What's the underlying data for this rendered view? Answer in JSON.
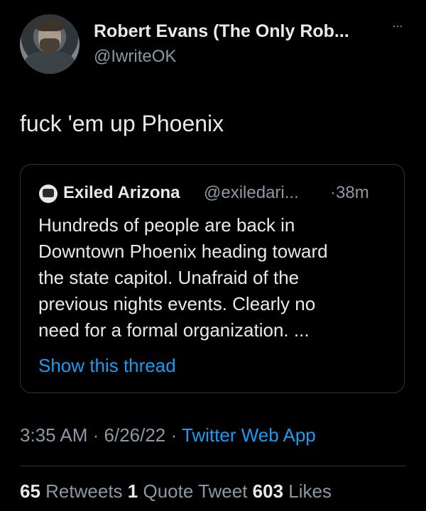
{
  "author": {
    "display_name": "Robert Evans (The Only Rob...",
    "handle": "@IwriteOK",
    "more_label": "···"
  },
  "tweet": {
    "text": "fuck 'em up Phoenix"
  },
  "quoted_tweet": {
    "display_name": "Exiled Arizona",
    "handle": "@exiledari...",
    "time": "·38m",
    "lines": [
      "Hundreds of people are back in",
      "Downtown Phoenix heading toward",
      "the state capitol. Unafraid of the",
      "previous nights events. Clearly no",
      "need for a formal organization. ..."
    ],
    "show_thread_label": "Show this thread"
  },
  "meta": {
    "time": "3:35 AM",
    "sep1": " · ",
    "date": "6/26/22",
    "sep2": " · ",
    "app": "Twitter Web App"
  },
  "stats": {
    "retweets_count": "65",
    "retweets_label": "Retweets",
    "quotes_count": "1",
    "quotes_label": "Quote Tweet",
    "likes_count": "603",
    "likes_label": "Likes"
  },
  "colors": {
    "background": "#000000",
    "text": "#e7e9ea",
    "secondary": "#8b98a5",
    "link": "#1d9bf0",
    "border": "#2f3336"
  }
}
